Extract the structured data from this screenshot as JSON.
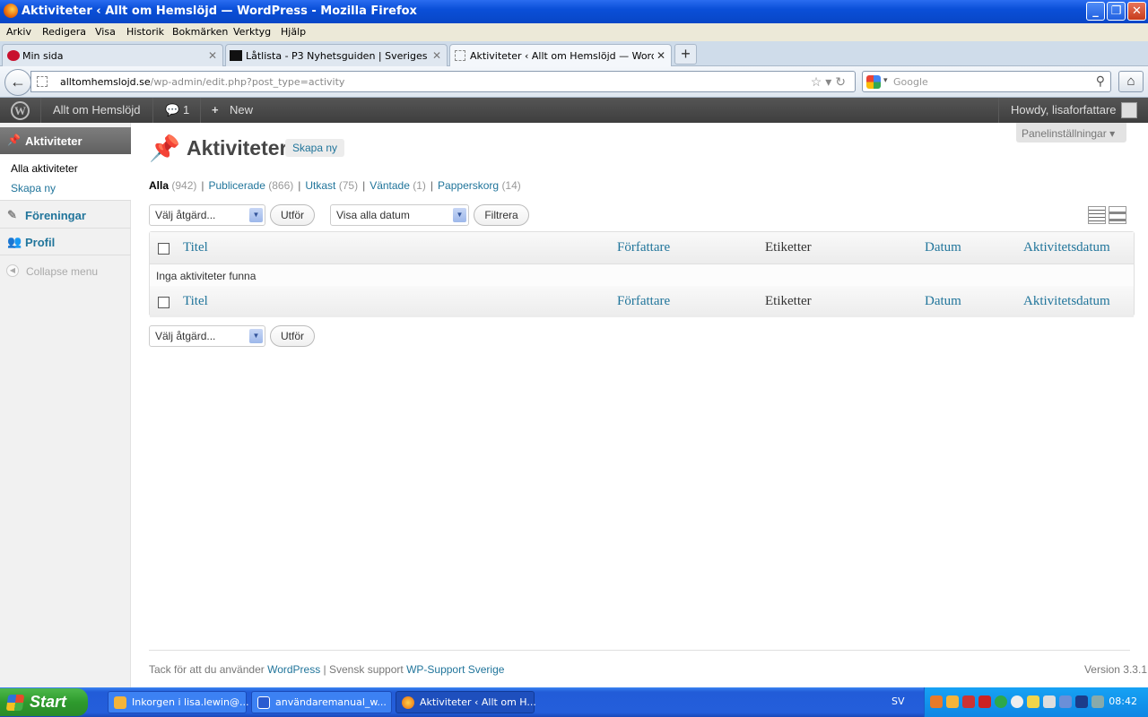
{
  "window": {
    "title": "Aktiviteter ‹ Allt om Hemslöjd — WordPress - Mozilla Firefox",
    "min": "_",
    "max": "❐",
    "close": "✕"
  },
  "menubar": [
    "Arkiv",
    "Redigera",
    "Visa",
    "Historik",
    "Bokmärken",
    "Verktyg",
    "Hjälp"
  ],
  "tabs": [
    {
      "label": "Min sida"
    },
    {
      "label": "Låtlista - P3 Nyhetsguiden | Sveriges Radio"
    },
    {
      "label": "Aktiviteter ‹ Allt om Hemslöjd — WordPress"
    }
  ],
  "tab_close": "✕",
  "new_tab": "+",
  "urlbar": {
    "domain": "alltomhemslojd.se",
    "path": "/wp-admin/edit.php?post_type=activity"
  },
  "search": {
    "placeholder": "Google"
  },
  "adminbar": {
    "site_name": "Allt om Hemslöjd",
    "comments_count": "1",
    "new_label": "New",
    "howdy": "Howdy, lisaforfattare"
  },
  "sidebar": {
    "active_menu": "Aktiviteter",
    "submenu": [
      "Alla aktiviteter",
      "Skapa ny"
    ],
    "items": [
      {
        "label": "Föreningar"
      },
      {
        "label": "Profil"
      }
    ],
    "collapse": "Collapse menu"
  },
  "main": {
    "screen_options": "Panelinställningar",
    "title": "Aktiviteter",
    "add_new": "Skapa ny",
    "filters": [
      {
        "label": "Alla",
        "count": "(942)"
      },
      {
        "label": "Publicerade",
        "count": "(866)"
      },
      {
        "label": "Utkast",
        "count": "(75)"
      },
      {
        "label": "Väntade",
        "count": "(1)"
      },
      {
        "label": "Papperskorg",
        "count": "(14)"
      }
    ],
    "bulk_action": "Välj åtgärd...",
    "apply": "Utför",
    "date_filter": "Visa alla datum",
    "filter_btn": "Filtrera",
    "columns": [
      "Titel",
      "Författare",
      "Etiketter",
      "Datum",
      "Aktivitetsdatum"
    ],
    "empty": "Inga aktiviteter funna"
  },
  "footer": {
    "thanks": "Tack för att du använder ",
    "wp": "WordPress",
    "sep": " | Svensk support ",
    "support": "WP-Support Sverige",
    "version": "Version 3.3.1"
  },
  "taskbar": {
    "start": "Start",
    "tasks": [
      "Inkorgen i lisa.lewin@...",
      "användaremanual_w...",
      "Aktiviteter ‹ Allt om H..."
    ],
    "lang": "SV",
    "clock": "08:42"
  }
}
